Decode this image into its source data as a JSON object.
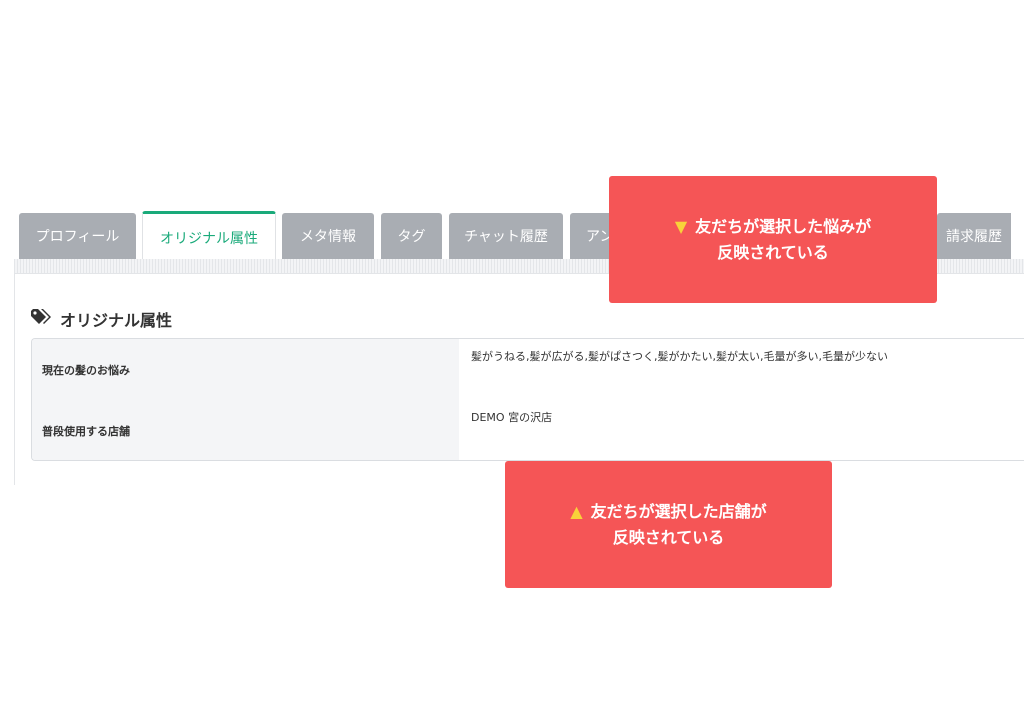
{
  "tabs": [
    {
      "label": "プロフィール"
    },
    {
      "label": "オリジナル属性",
      "active": true
    },
    {
      "label": "メタ情報"
    },
    {
      "label": "タグ"
    },
    {
      "label": "チャット履歴"
    },
    {
      "label": "アン"
    },
    {
      "label": "請求履歴"
    }
  ],
  "section": {
    "title": "オリジナル属性",
    "icon": "tags-icon",
    "rows": [
      {
        "label": "現在の髪のお悩み",
        "value": "髪がうねる,髪が広がる,髪がぱさつく,髪がかたい,髪が太い,毛量が多い,毛量が少ない"
      },
      {
        "label": "普段使用する店舗",
        "value": "DEMO 宮の沢店"
      }
    ]
  },
  "callouts": {
    "top": {
      "marker": "▼",
      "line1": "友だちが選択した悩みが",
      "line2": "反映されている"
    },
    "bottom": {
      "marker": "▲",
      "line1": "友だちが選択した店舗が",
      "line2": "反映されている"
    }
  },
  "colors": {
    "accent": "#1aaa7a",
    "callout": "#f55556",
    "marker": "#f8d23a",
    "tab_inactive": "#a9adb3"
  }
}
